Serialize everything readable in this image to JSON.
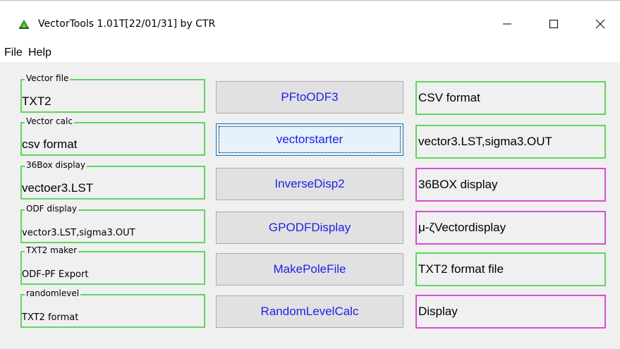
{
  "window": {
    "title": "VectorTools 1.01T[22/01/31] by CTR",
    "icon": "app-icon",
    "controls": [
      "minimize-icon",
      "maximize-icon",
      "close-icon"
    ]
  },
  "menu": {
    "items": [
      "File",
      "Help"
    ]
  },
  "groups": [
    {
      "caption": "Vector file",
      "value": "TXT2"
    },
    {
      "caption": "Vector calc",
      "value": "csv format"
    },
    {
      "caption": "36Box display",
      "value": "vectoer3.LST"
    },
    {
      "caption": "ODF display",
      "value": "vector3.LST,sigma3.OUT"
    },
    {
      "caption": "TXT2 maker",
      "value": "ODF-PF Export"
    },
    {
      "caption": "randomlevel",
      "value": "TXT2 format"
    }
  ],
  "buttons": [
    "PFtoODF3",
    "vectorstarter",
    "InverseDisp2",
    "GPODFDisplay",
    "MakePoleFile",
    "RandomLevelCalc"
  ],
  "outputs": [
    "CSV format",
    "vector3.LST,sigma3.OUT",
    "36BOX display",
    "μ-ζVectordisplay",
    "TXT2 format file",
    "Display"
  ],
  "colors": {
    "green_border": "#5fd65f",
    "magenta_border": "#d64fd6",
    "button_text": "#2020e6",
    "focus_border": "#0078d7"
  }
}
